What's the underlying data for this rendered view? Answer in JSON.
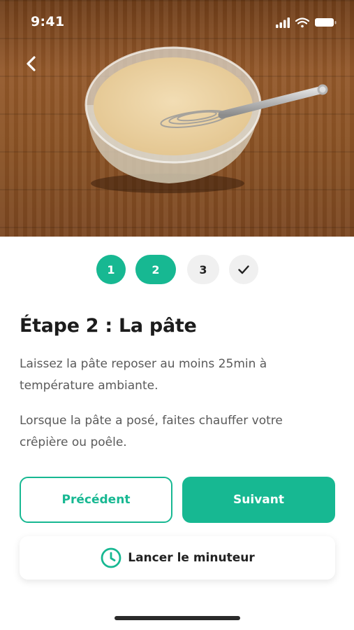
{
  "status_bar": {
    "time": "9:41"
  },
  "navigation": {
    "back_icon": "chevron-left-icon"
  },
  "stepper": {
    "steps": [
      {
        "label": "1",
        "state": "done"
      },
      {
        "label": "2",
        "state": "current"
      },
      {
        "label": "3",
        "state": "todo"
      },
      {
        "label": "",
        "icon": "checkmark-icon",
        "state": "todo"
      }
    ]
  },
  "step": {
    "title": "Étape 2 : La pâte",
    "paragraphs": [
      "Laissez la pâte reposer au moins 25min à température ambiante.",
      "Lorsque la pâte a posé, faites chauffer votre crêpière ou poêle."
    ]
  },
  "actions": {
    "previous_label": "Précédent",
    "next_label": "Suivant",
    "timer_label": "Lancer le minuteur",
    "timer_icon": "clock-icon"
  },
  "colors": {
    "accent": "#17b892",
    "step_inactive_bg": "#f0f0f0",
    "body_text": "#5a5a5a",
    "title_text": "#1c1c1c"
  }
}
